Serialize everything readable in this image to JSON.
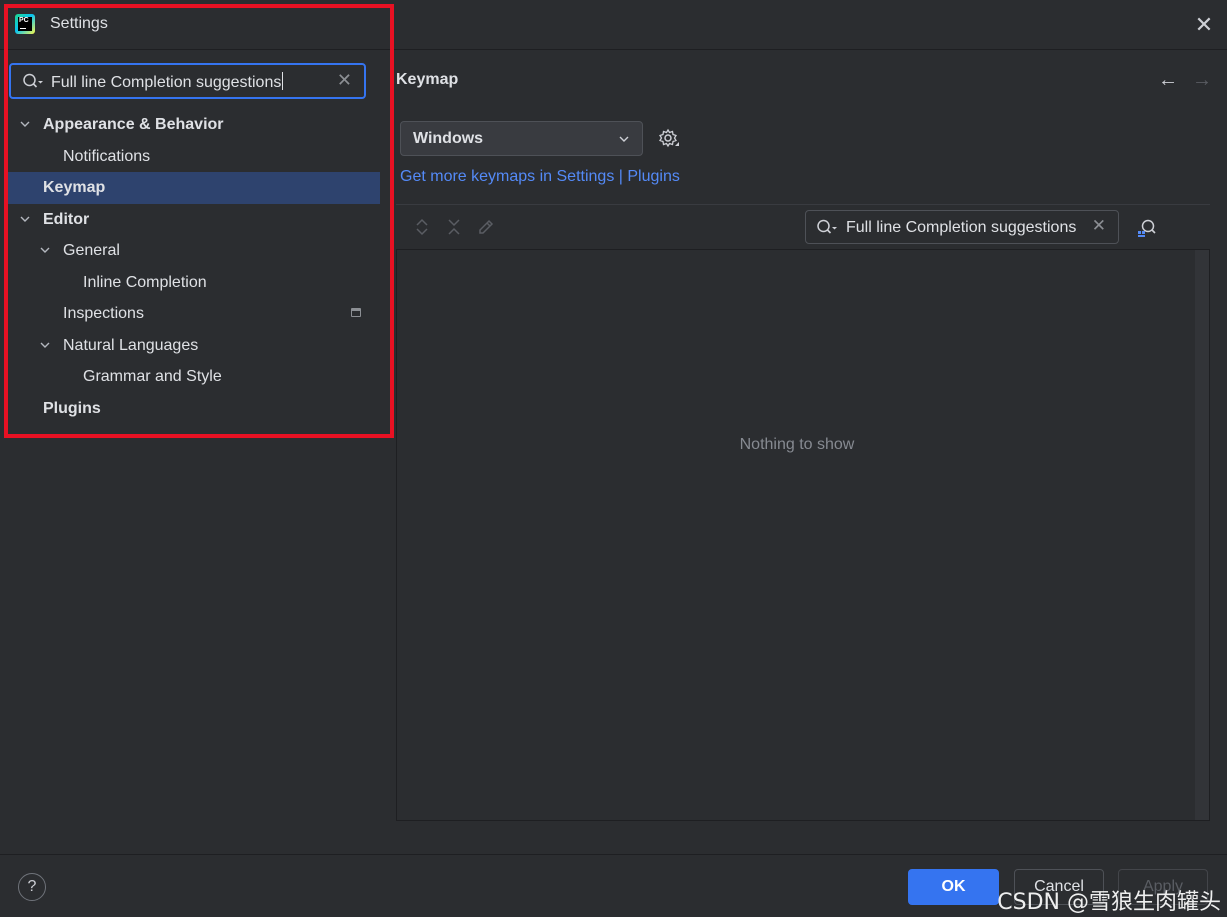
{
  "window": {
    "title": "Settings",
    "close_glyph": "✕"
  },
  "sidebar": {
    "search": {
      "value": "Full line Completion suggestions",
      "clear_glyph": "✕"
    },
    "tree": [
      {
        "label": "Appearance & Behavior",
        "expanded": true
      },
      {
        "label": "Notifications"
      },
      {
        "label": "Keymap",
        "selected": true
      },
      {
        "label": "Editor",
        "expanded": true
      },
      {
        "label": "General",
        "expanded": true
      },
      {
        "label": "Inline Completion"
      },
      {
        "label": "Inspections"
      },
      {
        "label": "Natural Languages",
        "expanded": true
      },
      {
        "label": "Grammar and Style"
      },
      {
        "label": "Plugins"
      }
    ]
  },
  "content": {
    "title": "Keymap",
    "nav": {
      "back": "←",
      "forward": "→"
    },
    "keymap_select": {
      "value": "Windows"
    },
    "link": "Get more keymaps in Settings | Plugins",
    "filter": {
      "value": "Full line Completion suggestions",
      "clear_glyph": "✕"
    },
    "empty_text": "Nothing to show"
  },
  "footer": {
    "help": "?",
    "ok": "OK",
    "cancel": "Cancel",
    "apply": "Apply",
    "watermark": "CSDN @雪狼生肉罐头"
  },
  "colors": {
    "accent": "#3574f0",
    "selection": "#2e436e",
    "highlight_box": "#e81123",
    "link": "#548af7",
    "background": "#2b2d30"
  }
}
